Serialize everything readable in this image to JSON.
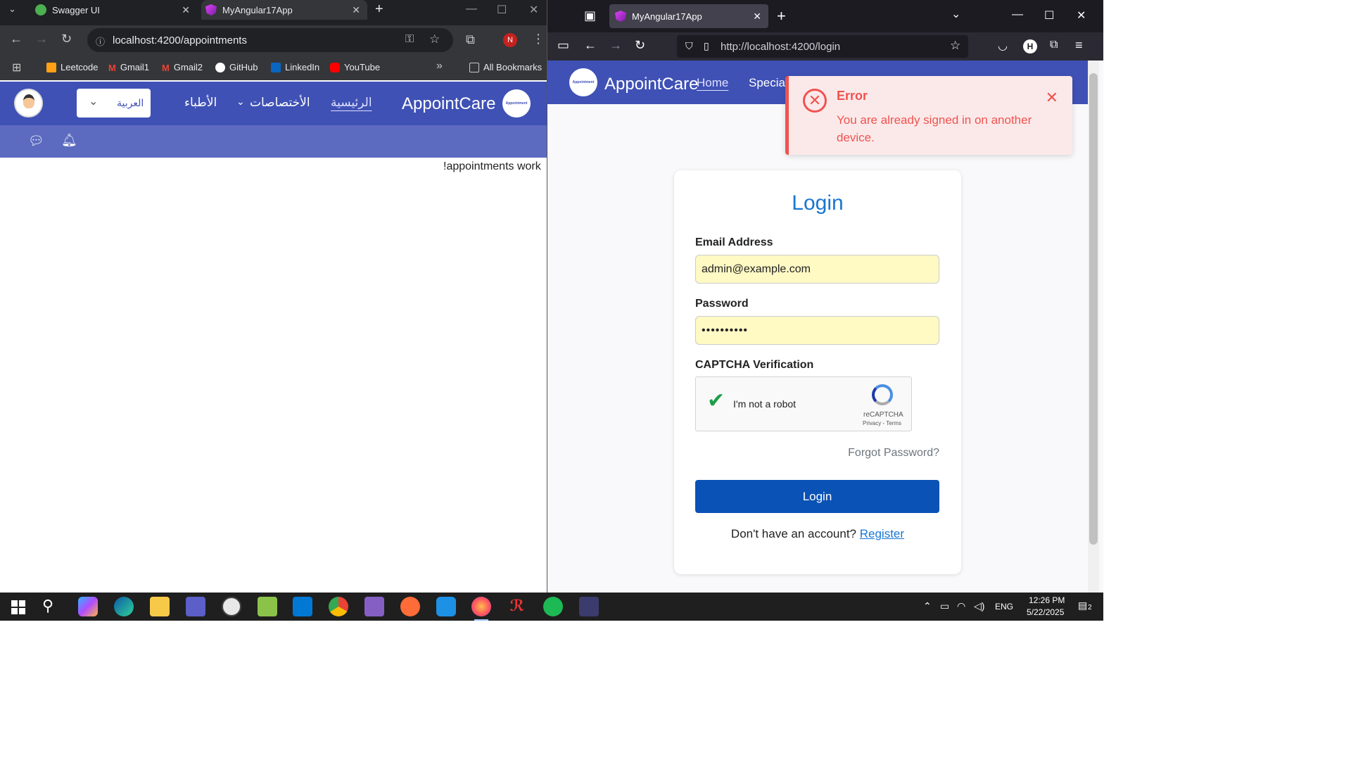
{
  "chrome": {
    "tabs": [
      {
        "title": "Swagger UI"
      },
      {
        "title": "MyAngular17App"
      }
    ],
    "address": "localhost:4200/appointments",
    "profile_initial": "N",
    "bookmarks": [
      "Leetcode",
      "Gmail1",
      "Gmail2",
      "GitHub",
      "LinkedIn",
      "YouTube"
    ],
    "all_bookmarks": "All Bookmarks",
    "app": {
      "brand": "AppointCare",
      "logo_text": "Appointment",
      "nav_home": "الرئيسية",
      "nav_specialties": "الأختصاصات",
      "nav_doctors": "الأطباء",
      "language": "العربية"
    },
    "content": "!appointments work"
  },
  "firefox": {
    "tab_title": "MyAngular17App",
    "address": "http://localhost:4200/login",
    "profile_initial": "H",
    "app": {
      "brand": "AppointCare",
      "logo_text": "Appointment",
      "nav_home": "Home",
      "nav_special": "Special"
    },
    "toast": {
      "title": "Error",
      "message": "You are already signed in on another device."
    },
    "login": {
      "title": "Login",
      "email_label": "Email Address",
      "email_value": "admin@example.com",
      "password_label": "Password",
      "password_value": "••••••••••",
      "captcha_label": "CAPTCHA Verification",
      "captcha_text": "I'm not a robot",
      "captcha_brand": "reCAPTCHA",
      "captcha_links": "Privacy - Terms",
      "forgot": "Forgot Password?",
      "button": "Login",
      "no_account": "Don't have an account?",
      "register": "Register"
    }
  },
  "taskbar": {
    "language": "ENG",
    "time": "12:26 PM",
    "date": "5/22/2025",
    "notifications": "2"
  }
}
